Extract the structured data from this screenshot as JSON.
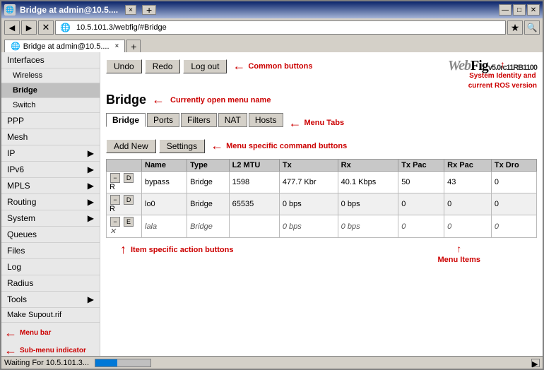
{
  "window": {
    "title": "Bridge at admin@10.5....",
    "tab_label": "Bridge at admin@10.5....",
    "tab_close": "×",
    "tab_add": "+",
    "btn_minimize": "—",
    "btn_maximize": "□",
    "btn_close": "✕"
  },
  "browser": {
    "back": "◀",
    "forward": "▶",
    "reload": "✕",
    "address": "10.5.101.3/webfig/#Bridge",
    "star": "★",
    "search": "🔍",
    "new_tab": "+"
  },
  "toolbar": {
    "undo": "Undo",
    "redo": "Redo",
    "logout": "Log out",
    "annotation": "Common buttons",
    "brand_web": "Web",
    "brand_fig": "Fig",
    "brand_version": "v5.0rc11RB1100",
    "identity_annotation": "System Identity and\ncurrent ROS version"
  },
  "page": {
    "title": "Bridge",
    "title_annotation": "Currently open menu name"
  },
  "menu_tabs": [
    {
      "label": "Bridge",
      "active": true
    },
    {
      "label": "Ports",
      "active": false
    },
    {
      "label": "Filters",
      "active": false
    },
    {
      "label": "NAT",
      "active": false
    },
    {
      "label": "Hosts",
      "active": false
    }
  ],
  "tabs_annotation": "Menu Tabs",
  "action_buttons": {
    "add_new": "Add New",
    "settings": "Settings",
    "annotation": "Menu specific command buttons"
  },
  "table": {
    "headers": [
      "",
      "Name",
      "Type",
      "L2 MTU",
      "Tx",
      "Rx",
      "Tx Pac",
      "Rx Pac",
      "Tx Dro"
    ],
    "rows": [
      {
        "btns": [
          "−",
          "D"
        ],
        "flag": "R",
        "name": "bypass",
        "type": "Bridge",
        "l2mtu": "1598",
        "tx": "477.7 Kbr",
        "rx": "40.1 Kbps",
        "txpac": "50",
        "rxpac": "43",
        "txdro": "0",
        "italic": false
      },
      {
        "btns": [
          "−",
          "D"
        ],
        "flag": "R",
        "name": "lo0",
        "type": "Bridge",
        "l2mtu": "65535",
        "tx": "0 bps",
        "rx": "0 bps",
        "txpac": "0",
        "rxpac": "0",
        "txdro": "0",
        "italic": false
      },
      {
        "btns": [
          "−",
          "E"
        ],
        "flag": "X",
        "name": "lala",
        "type": "Bridge",
        "l2mtu": "",
        "tx": "0 bps",
        "rx": "0 bps",
        "txpac": "0",
        "rxpac": "0",
        "txdro": "0",
        "italic": true
      }
    ],
    "items_annotation": "Menu Items",
    "action_annotation": "Item specific action buttons"
  },
  "sidebar": {
    "items": [
      {
        "label": "Interfaces",
        "has_arrow": false,
        "active": false
      },
      {
        "label": "Wireless",
        "has_arrow": false,
        "active": false
      },
      {
        "label": "Bridge",
        "has_arrow": false,
        "active": true
      },
      {
        "label": "Switch",
        "has_arrow": false,
        "active": false
      },
      {
        "label": "PPP",
        "has_arrow": false,
        "active": false
      },
      {
        "label": "Mesh",
        "has_arrow": false,
        "active": false
      },
      {
        "label": "IP",
        "has_arrow": true,
        "active": false
      },
      {
        "label": "IPv6",
        "has_arrow": true,
        "active": false
      },
      {
        "label": "MPLS",
        "has_arrow": true,
        "active": false
      },
      {
        "label": "Routing",
        "has_arrow": true,
        "active": false
      },
      {
        "label": "System",
        "has_arrow": true,
        "active": false
      },
      {
        "label": "Queues",
        "has_arrow": false,
        "active": false
      },
      {
        "label": "Files",
        "has_arrow": false,
        "active": false
      },
      {
        "label": "Log",
        "has_arrow": false,
        "active": false
      },
      {
        "label": "Radius",
        "has_arrow": false,
        "active": false
      },
      {
        "label": "Tools",
        "has_arrow": true,
        "active": false
      },
      {
        "label": "Make Supout.rif",
        "has_arrow": false,
        "active": false
      }
    ],
    "menubar_annotation": "Menu bar",
    "submenu_annotation": "Sub-menu indicator"
  },
  "status_bar": {
    "text": "Waiting For 10.5.101.3..."
  }
}
